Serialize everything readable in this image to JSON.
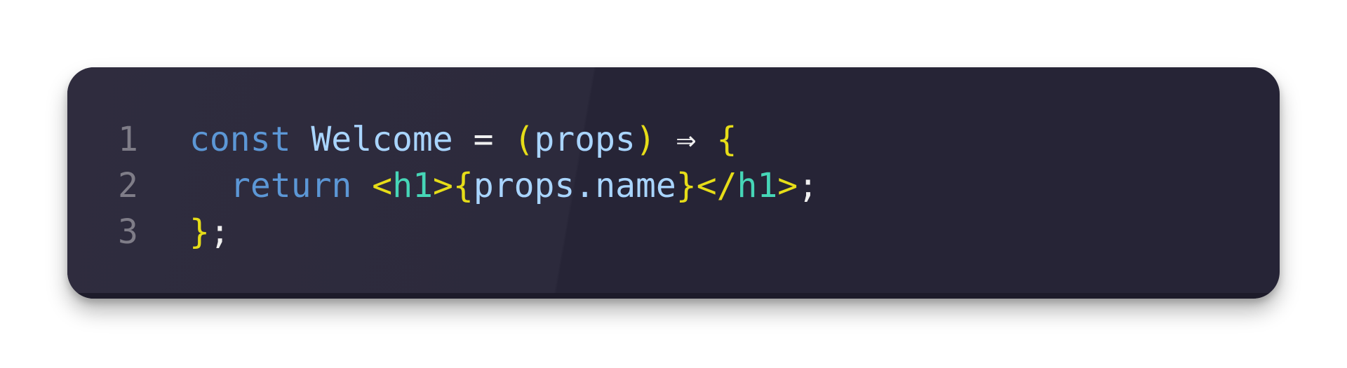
{
  "editor": {
    "lines": [
      {
        "number": "1",
        "tokens": {
          "const": "const",
          "space1": " ",
          "name": "Welcome",
          "space2": " ",
          "equals": "=",
          "space3": " ",
          "paren_open": "(",
          "param": "props",
          "paren_close": ")",
          "space4": " ",
          "arrow": "⇒",
          "space5": " ",
          "brace_open": "{"
        }
      },
      {
        "number": "2",
        "tokens": {
          "return": "return",
          "space1": " ",
          "tag_open": "<",
          "tag_name": "h1",
          "tag_close": ">",
          "expr_open": "{",
          "expr": "props.name",
          "expr_close": "}",
          "end_tag_open": "</",
          "end_tag_name": "h1",
          "end_tag_close": ">",
          "semicolon": ";"
        }
      },
      {
        "number": "3",
        "tokens": {
          "brace_close": "}",
          "semicolon": ";"
        }
      }
    ]
  },
  "colors": {
    "background": "#262436",
    "keyword": "#5c97d6",
    "identifier": "#a9d5ff",
    "brace": "#e6dd18",
    "tag": "#46d6b7",
    "line_number": "#7f7d88"
  }
}
